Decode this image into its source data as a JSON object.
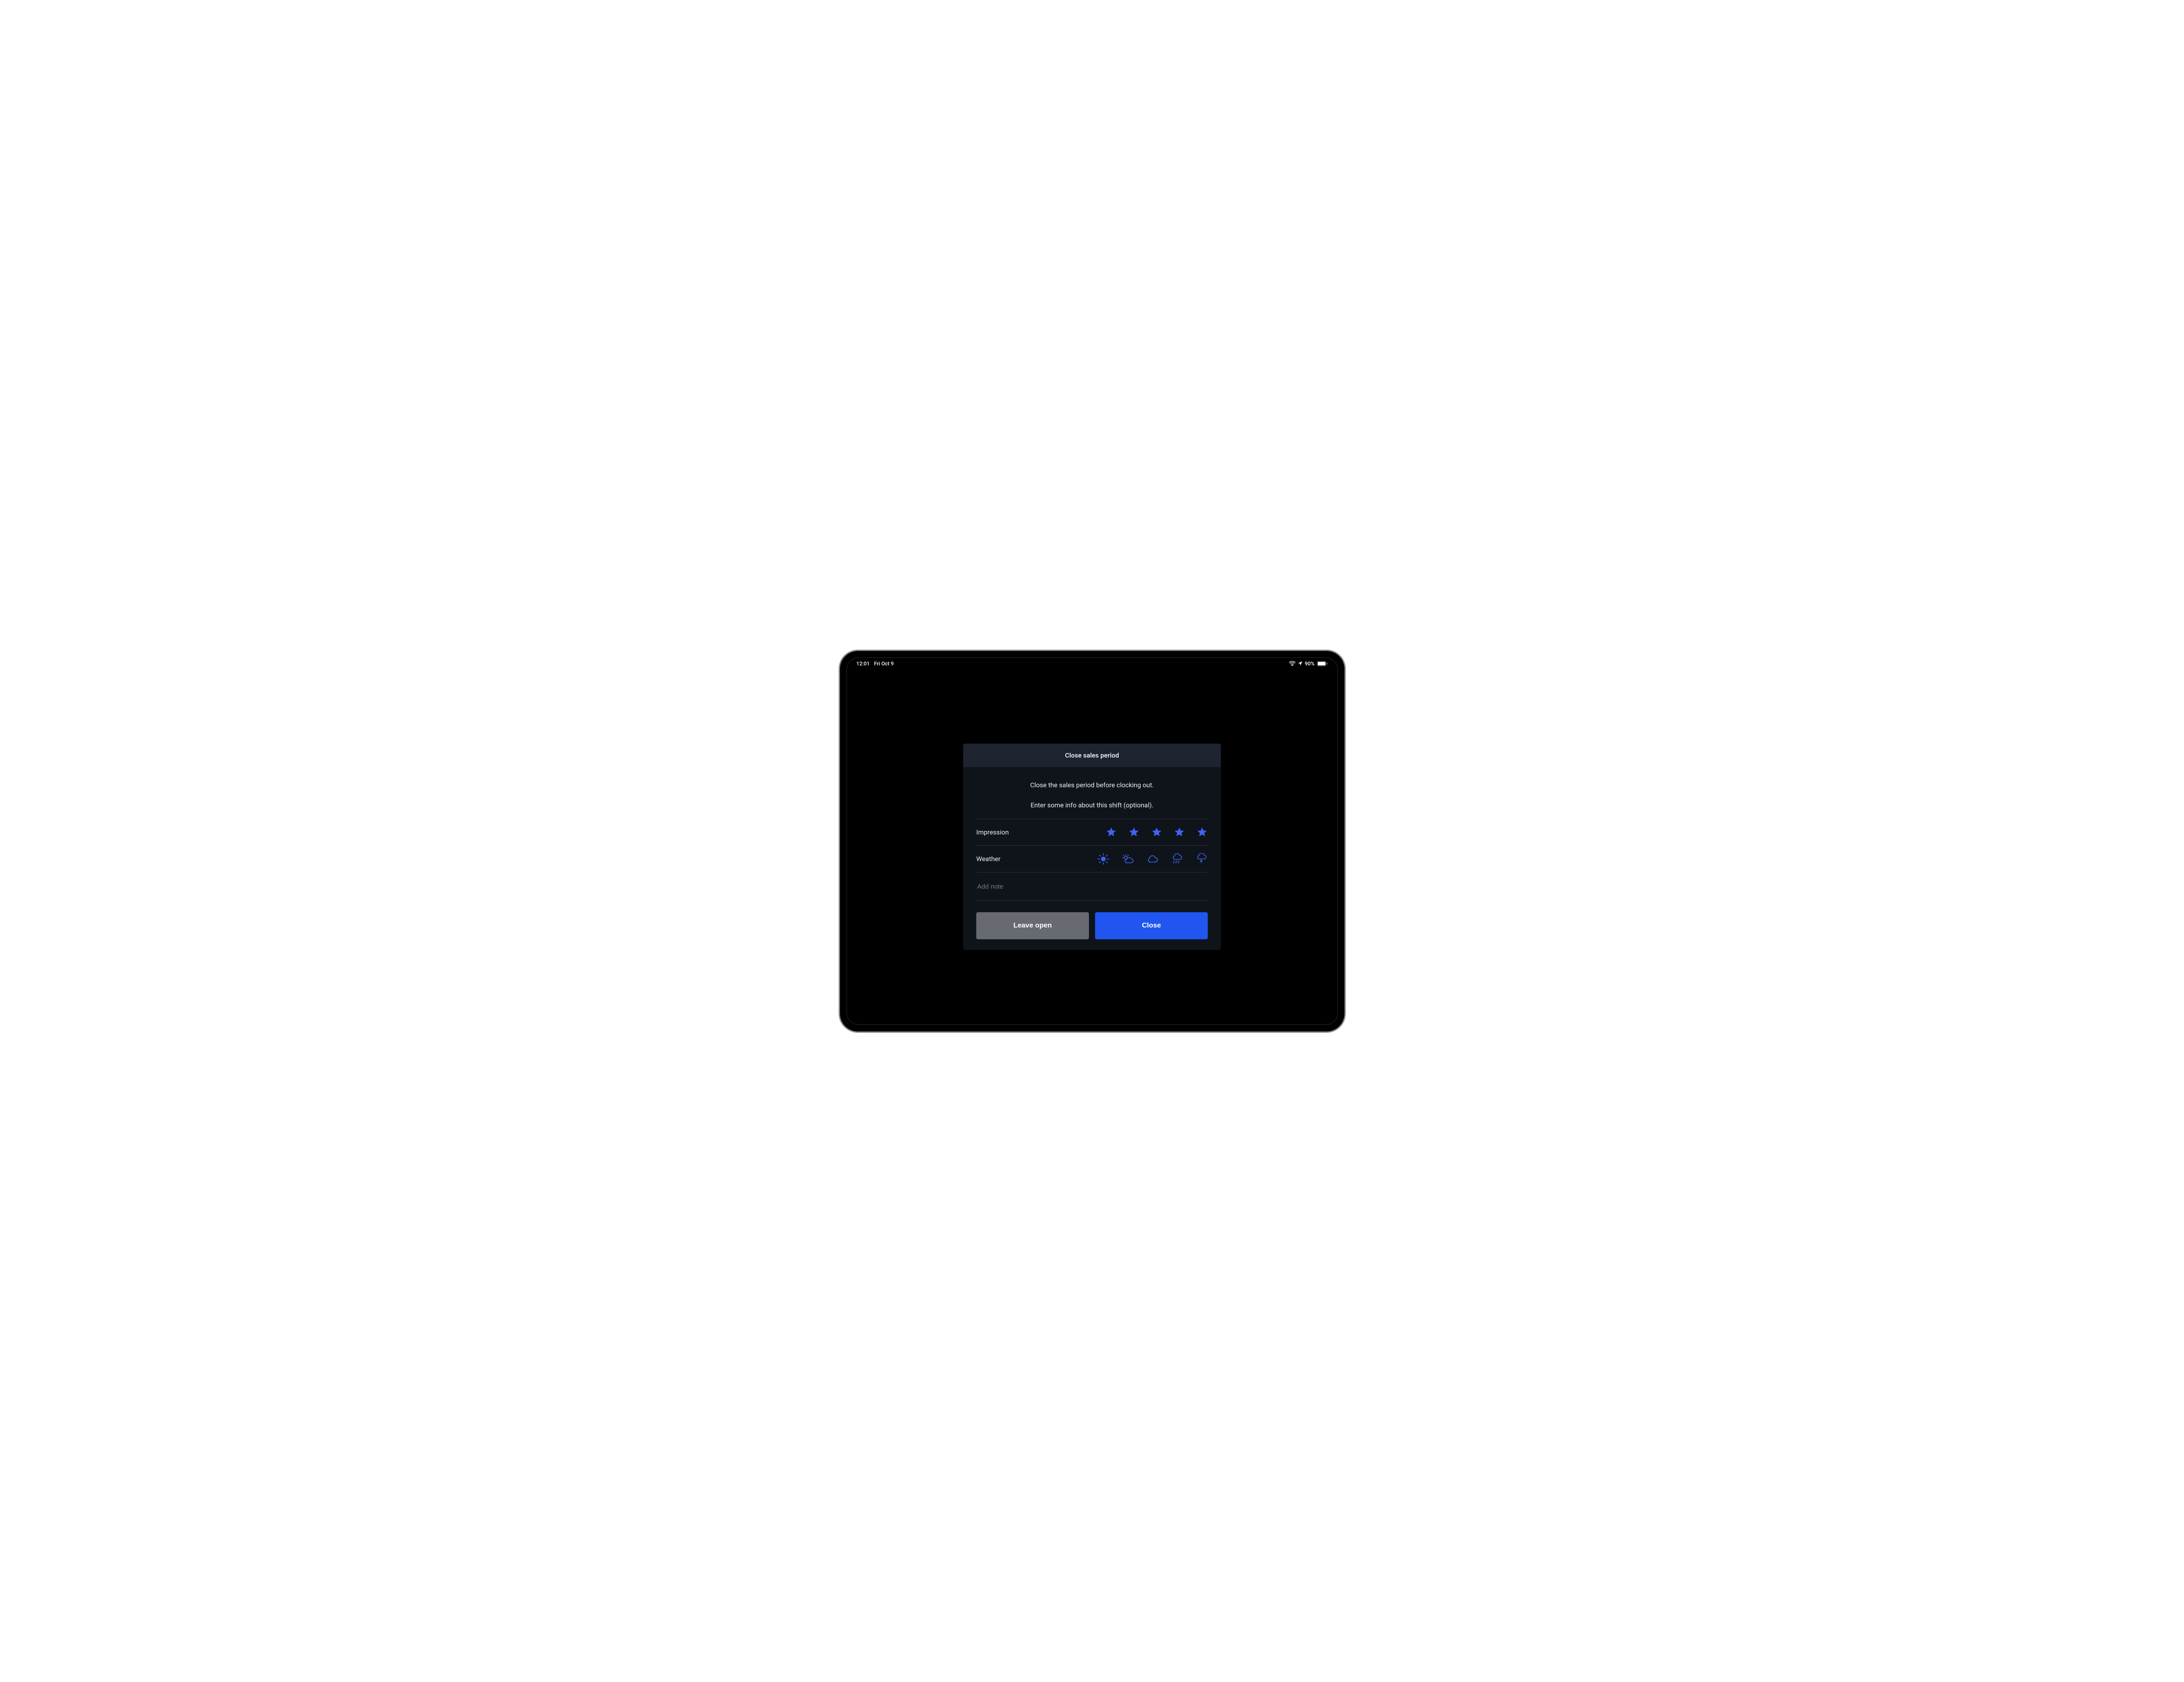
{
  "statusbar": {
    "time": "12:01",
    "date": "Fri Oct 9",
    "battery_pct": "90%"
  },
  "dialog": {
    "title": "Close sales period",
    "message_primary": "Close the sales period before clocking out.",
    "message_secondary": "Enter some info about this shift (optional).",
    "labels": {
      "impression": "Impression",
      "weather": "Weather"
    },
    "note_placeholder": "Add note",
    "buttons": {
      "leave_open": "Leave open",
      "close": "Close"
    },
    "impression_rating": 5,
    "weather_options": [
      "sunny",
      "partly-cloudy",
      "cloudy",
      "rain",
      "thunder"
    ]
  },
  "colors": {
    "accent": "#3d63ff",
    "primary_button": "#2055ef",
    "secondary_button": "#676a70"
  }
}
